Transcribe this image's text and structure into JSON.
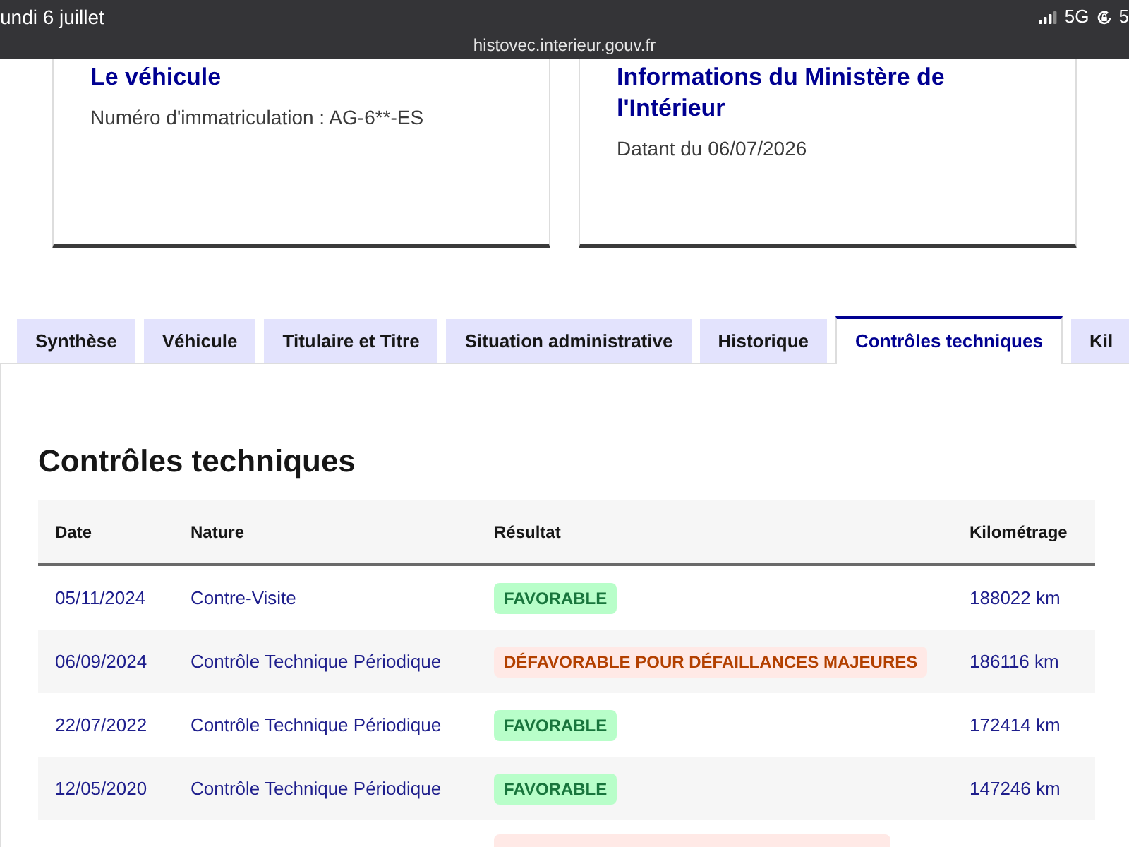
{
  "status_bar": {
    "date": "undi 6 juillet",
    "network": "5G",
    "battery": "5",
    "url": "histovec.interieur.gouv.fr"
  },
  "cards": [
    {
      "title": "Le véhicule",
      "text": "Numéro d'immatriculation : AG-6**-ES"
    },
    {
      "title": "Informations du Ministère de l'Intérieur",
      "text": "Datant du 06/07/2026"
    }
  ],
  "tabs": [
    {
      "label": "Synthèse",
      "selected": false
    },
    {
      "label": "Véhicule",
      "selected": false
    },
    {
      "label": "Titulaire et Titre",
      "selected": false
    },
    {
      "label": "Situation administrative",
      "selected": false
    },
    {
      "label": "Historique",
      "selected": false
    },
    {
      "label": "Contrôles techniques",
      "selected": true
    },
    {
      "label": "Kil",
      "selected": false
    }
  ],
  "section": {
    "title": "Contrôles techniques",
    "table": {
      "columns": [
        "Date",
        "Nature",
        "Résultat",
        "Kilométrage"
      ],
      "rows": [
        {
          "date": "05/11/2024",
          "nature": "Contre-Visite",
          "result": {
            "kind": "favorable",
            "label": "FAVORABLE"
          },
          "mileage": "188022 km"
        },
        {
          "date": "06/09/2024",
          "nature": "Contrôle Technique Périodique",
          "result": {
            "kind": "unfavorable",
            "label": "DÉFAVORABLE POUR DÉFAILLANCES MAJEURES"
          },
          "mileage": "186116 km"
        },
        {
          "date": "22/07/2022",
          "nature": "Contrôle Technique Périodique",
          "result": {
            "kind": "favorable",
            "label": "FAVORABLE"
          },
          "mileage": "172414 km"
        },
        {
          "date": "12/05/2020",
          "nature": "Contrôle Technique Périodique",
          "result": {
            "kind": "favorable",
            "label": "FAVORABLE"
          },
          "mileage": "147246 km"
        },
        {
          "result": {
            "kind": "unfavorable"
          }
        }
      ]
    }
  }
}
